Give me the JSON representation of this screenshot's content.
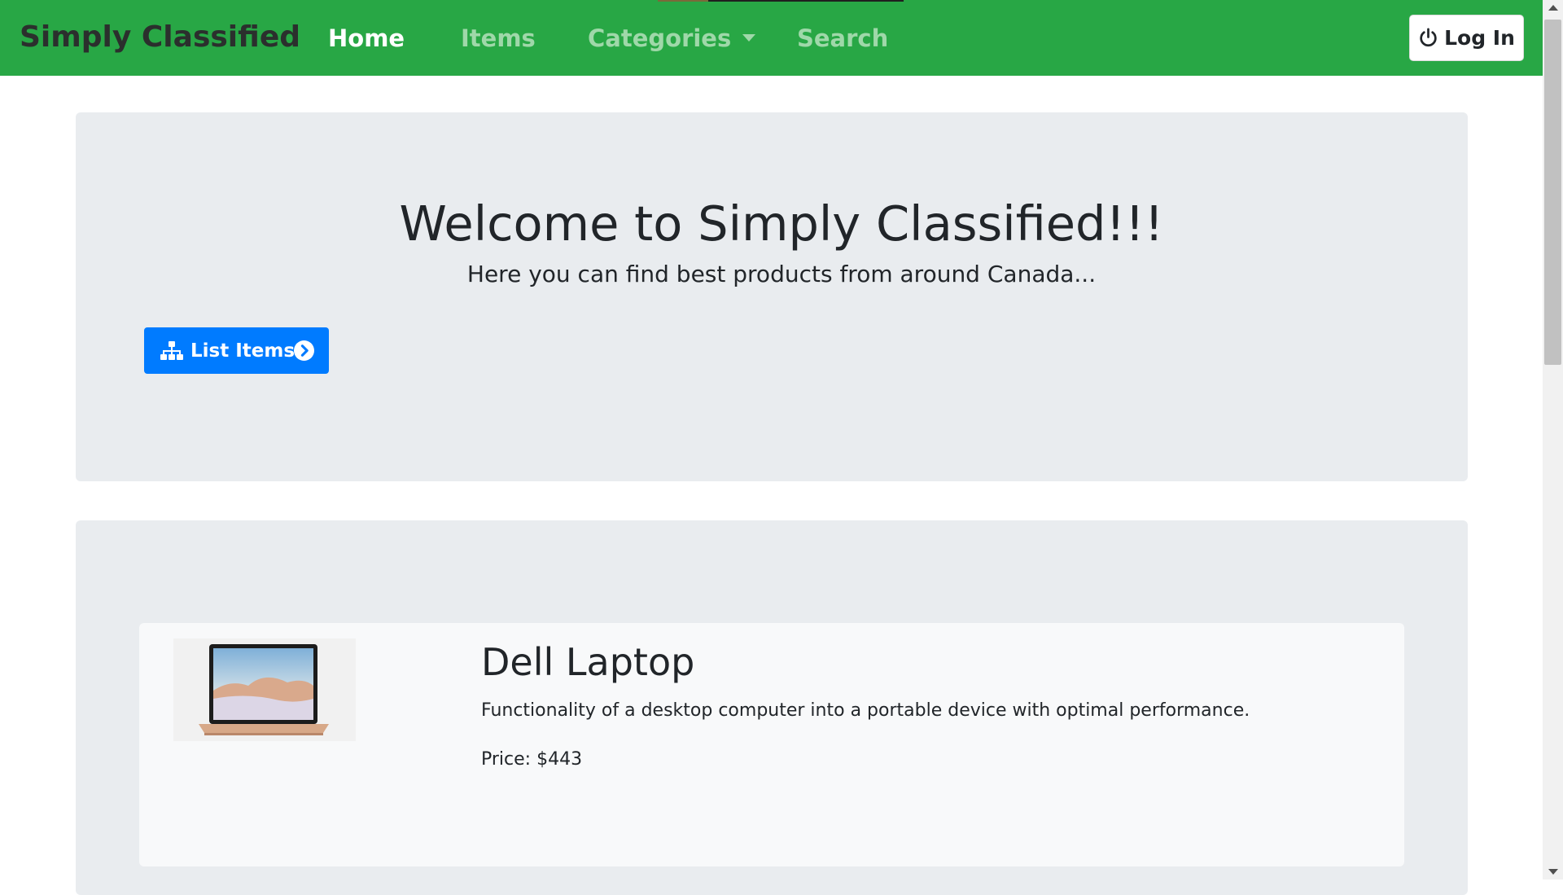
{
  "navbar": {
    "brand": "Simply Classified",
    "links": [
      {
        "label": "Home",
        "active": true
      },
      {
        "label": "Items",
        "active": false
      },
      {
        "label": "Categories",
        "active": false,
        "dropdown": true
      },
      {
        "label": "Search",
        "active": false
      }
    ],
    "login_label": "Log In",
    "login_icon": "power-icon"
  },
  "hero": {
    "title": "Welcome to Simply Classified!!!",
    "subtitle": "Here you can find best products from around Canada...",
    "button_label": "List Items",
    "button_icon": "sitemap-icon",
    "button_arrow_icon": "arrow-circle-right-icon"
  },
  "items": [
    {
      "name": "Dell Laptop",
      "description": "Functionality of a desktop computer into a portable device with optimal performance.",
      "price": "Price: $443",
      "image": "laptop-image"
    }
  ],
  "colors": {
    "navbar": "#28a745",
    "primary_button": "#007bff",
    "jumbotron": "#e9ecef",
    "card": "#f8f9fa"
  }
}
